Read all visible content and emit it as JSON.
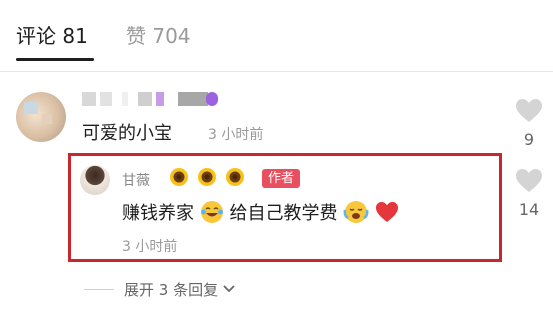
{
  "tabs": [
    {
      "label": "评论 81"
    },
    {
      "label": "赞 704"
    }
  ],
  "comment": {
    "avatar": "blurred-avatar",
    "text": "可爱的小宝",
    "time": "3 小时前",
    "likes": "9"
  },
  "reply": {
    "author": "甘薇",
    "badge": "作者",
    "text_part1": "赚钱养家",
    "text_part2": "给自己教学费",
    "time": "3 小时前",
    "likes": "14",
    "emoji": [
      "sunflower-icon",
      "sunflower-icon",
      "sunflower-icon",
      "laughing-tears-icon",
      "crying-icon",
      "red-heart-icon"
    ]
  },
  "expand": {
    "label": "展开 3 条回复"
  },
  "colors": {
    "highlight_border": "#c8282b",
    "author_badge": "#ea4f5f",
    "heart": "#e5363b"
  }
}
